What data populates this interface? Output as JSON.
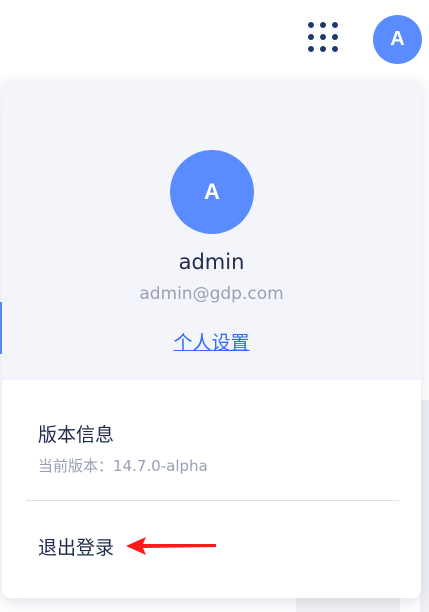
{
  "topbar": {
    "apps_icon": "apps-grid-icon",
    "avatar_initial": "A",
    "avatar_color": "#5b8cff"
  },
  "profile": {
    "avatar_initial": "A",
    "username": "admin",
    "email": "admin@gdp.com",
    "settings_label": "个人设置"
  },
  "version": {
    "title": "版本信息",
    "current": "当前版本：14.7.0-alpha"
  },
  "logout_label": "退出登录",
  "colors": {
    "accent": "#5b8cff",
    "link": "#2f6bff",
    "text": "#1f2b4d",
    "muted": "#9aa0b4",
    "panel": "#f4f5fa",
    "annotation": "#ff1a1a"
  }
}
